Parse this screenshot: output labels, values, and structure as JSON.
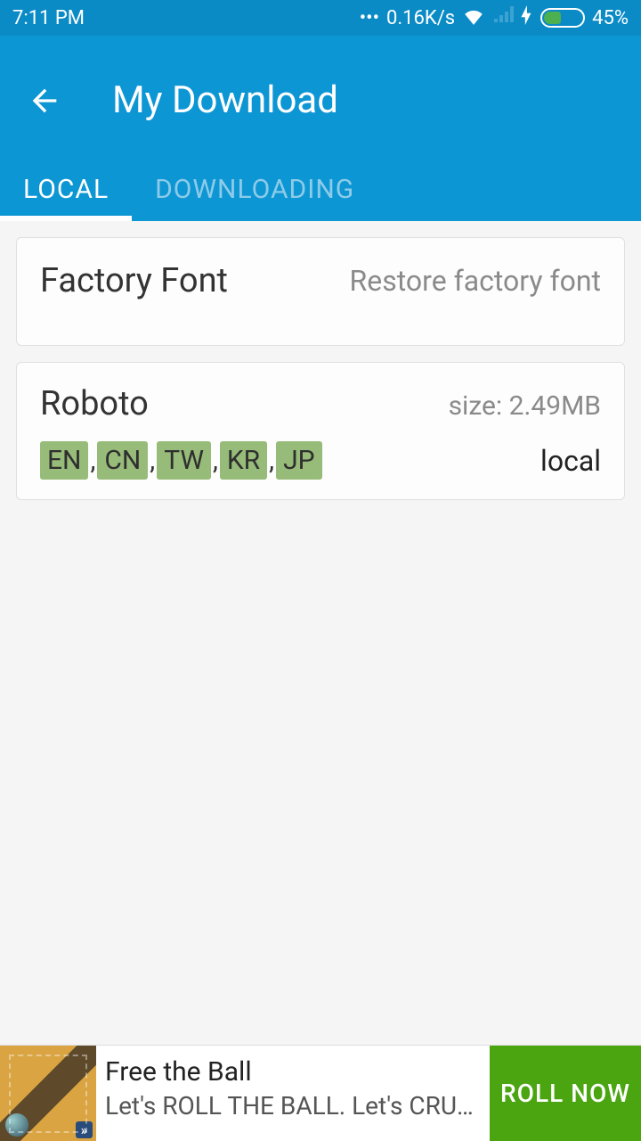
{
  "status": {
    "time": "7:11 PM",
    "net_speed": "0.16K/s",
    "battery_pct": "45%"
  },
  "appbar": {
    "title": "My Download"
  },
  "tabs": {
    "local": "LOCAL",
    "downloading": "DOWNLOADING"
  },
  "factory_card": {
    "title": "Factory Font",
    "action": "Restore factory font"
  },
  "font_card": {
    "name": "Roboto",
    "size_label": "size: 2.49MB",
    "tags": [
      "EN",
      "CN",
      "TW",
      "KR",
      "JP"
    ],
    "status": "local"
  },
  "ad": {
    "title": "Free the Ball",
    "desc": "Let's ROLL THE BALL. Let's CRUSH T…",
    "cta": "ROLL NOW"
  }
}
